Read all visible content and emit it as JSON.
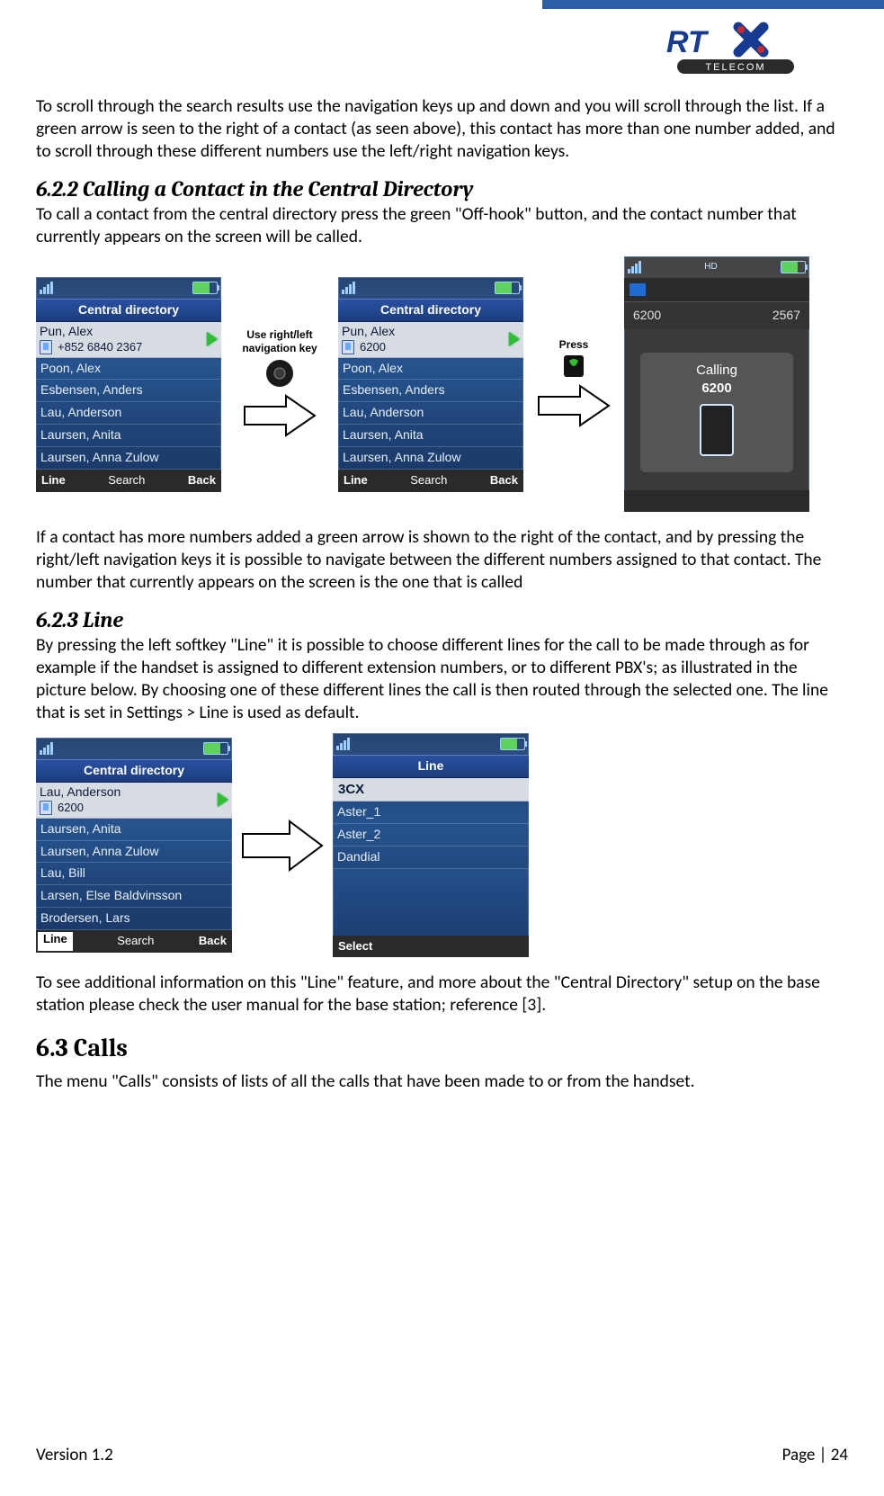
{
  "logo": {
    "brand_top": "RTX",
    "brand_sub": "TELECOM"
  },
  "para_intro": "To scroll through the search results use the navigation keys up and down and you will scroll through the list. If a green arrow is seen to the right of a contact (as seen above), this contact has more than one number added, and to scroll through these different numbers use the left/right navigation keys.",
  "h_622": "6.2.2 Calling a Contact in the Central Directory",
  "para_622": "To call a contact from the central directory press the green \"Off-hook\" button, and the contact number that currently appears on the screen will be called.",
  "annot1": "Use right/left\nnavigation key",
  "annot2": "Press",
  "screen_a": {
    "title": "Central directory",
    "sel_name": "Pun, Alex",
    "sel_num": "+852 6840 2367",
    "rows": [
      "Poon, Alex",
      "Esbensen, Anders",
      "Lau, Anderson",
      "Laursen, Anita",
      "Laursen, Anna Zulow"
    ],
    "soft": {
      "l": "Line",
      "m": "Search",
      "r": "Back"
    }
  },
  "screen_b": {
    "title": "Central directory",
    "sel_name": "Pun, Alex",
    "sel_num": "6200",
    "rows": [
      "Poon, Alex",
      "Esbensen, Anders",
      "Lau, Anderson",
      "Laursen, Anita",
      "Laursen, Anna Zulow"
    ],
    "soft": {
      "l": "Line",
      "m": "Search",
      "r": "Back"
    }
  },
  "screen_c": {
    "hd": "HD",
    "left_num": "6200",
    "right_num": "2567",
    "calling_label": "Calling",
    "calling_num": "6200"
  },
  "para_after_row1": "If a contact has more numbers added a green arrow is shown to the right of the contact, and by pressing the right/left navigation keys it is possible to navigate between the different numbers assigned to that contact. The number that currently appears on the screen is the one that is called",
  "h_623": "6.2.3 Line",
  "para_623": "By pressing the left softkey \"Line\" it is possible to choose different lines for the call to be made through as for example if the handset is assigned to different extension numbers, or to different PBX's; as illustrated in the picture below. By choosing one of these different lines the call is then routed through the selected one. The line that is set in Settings > Line is used as default.",
  "screen_d": {
    "title": "Central directory",
    "sel_name": "Lau, Anderson",
    "sel_num": "6200",
    "rows": [
      "Laursen, Anita",
      "Laursen, Anna Zulow",
      "Lau, Bill",
      "Larsen, Else Baldvinsson",
      "Brodersen, Lars"
    ],
    "soft": {
      "l": "Line",
      "m": "Search",
      "r": "Back"
    }
  },
  "screen_e": {
    "title": "Line",
    "sel_line": "3CX",
    "rows": [
      "Aster_1",
      "Aster_2",
      "Dandial"
    ],
    "soft_select": "Select"
  },
  "para_after_row2": "To see additional information on this \"Line\" feature, and more about the \"Central Directory\" setup on the base station please check the user manual for the base station; reference [3].",
  "h_63": "6.3 Calls",
  "para_63": "The menu \"Calls\" consists of lists of all the calls that have been made to or from the handset.",
  "footer": {
    "version": "Version 1.2",
    "page": "Page | 24"
  }
}
